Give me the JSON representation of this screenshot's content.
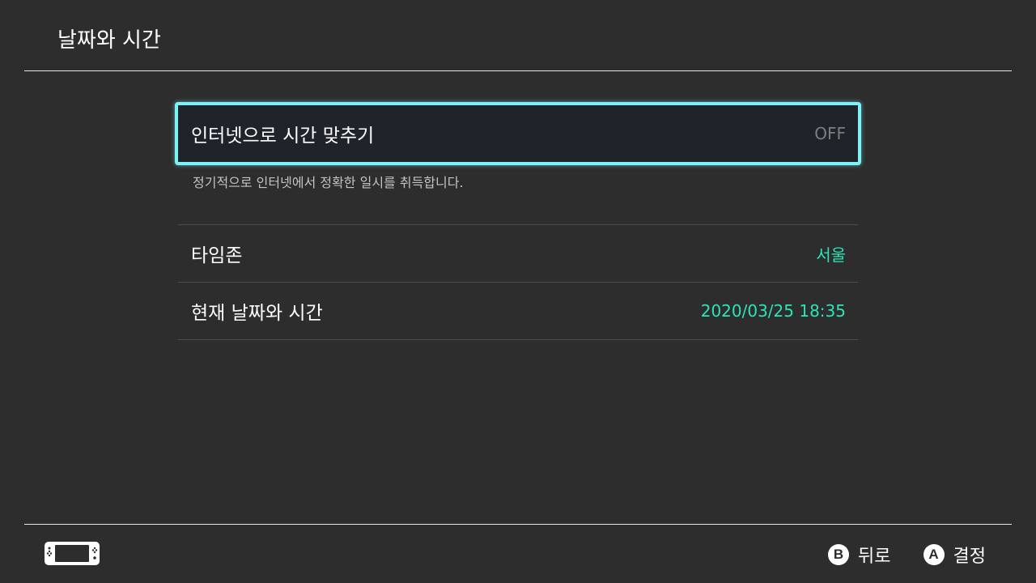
{
  "header": {
    "title": "날짜와 시간"
  },
  "settings": {
    "internet_sync": {
      "label": "인터넷으로 시간 맞추기",
      "value": "OFF",
      "description": "정기적으로 인터넷에서 정확한 일시를 취득합니다."
    },
    "items": [
      {
        "label": "타임존",
        "value": "서울"
      },
      {
        "label": "현재 날짜와 시간",
        "value": "2020/03/25 18:35"
      }
    ]
  },
  "footer": {
    "device_icon": "handheld-console-icon",
    "back": {
      "button": "B",
      "label": "뒤로"
    },
    "confirm": {
      "button": "A",
      "label": "결정"
    }
  },
  "colors": {
    "background": "#2d2d2d",
    "selection_border": "#7df3f7",
    "accent_value": "#2de3b8",
    "off_value": "#7e7e7e"
  }
}
